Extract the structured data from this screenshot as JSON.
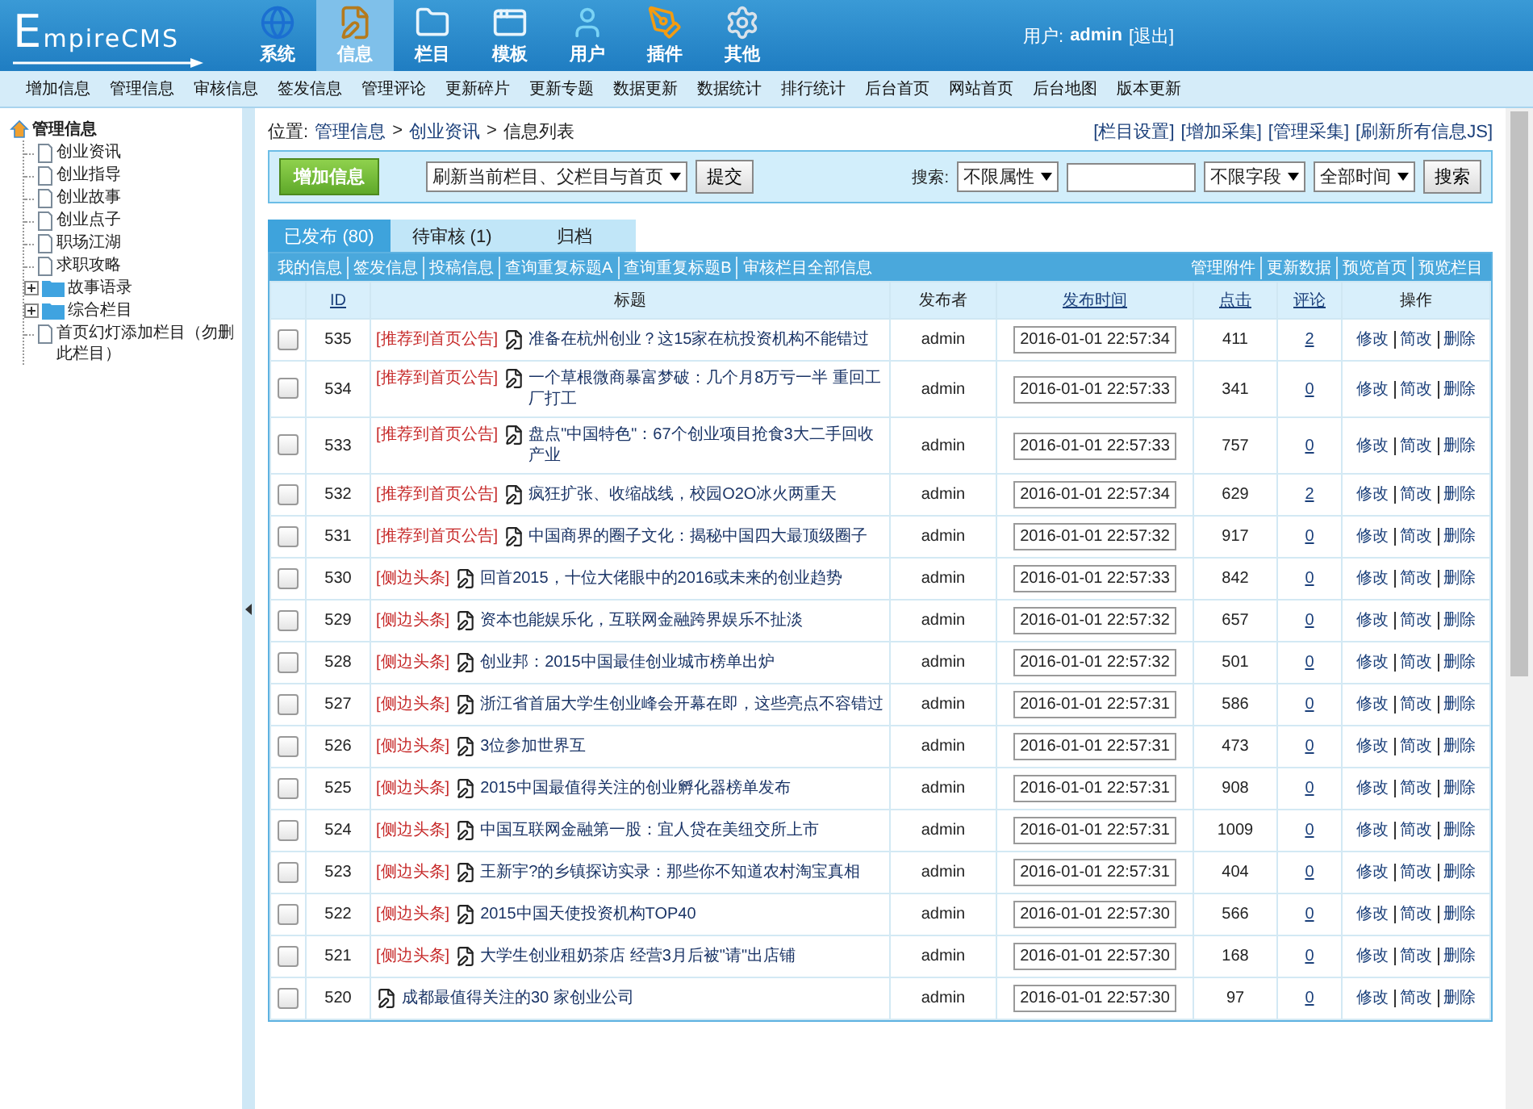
{
  "header": {
    "logo": "EmpireCMS",
    "nav": [
      {
        "label": "系统",
        "selected": false
      },
      {
        "label": "信息",
        "selected": true
      },
      {
        "label": "栏目",
        "selected": false
      },
      {
        "label": "模板",
        "selected": false
      },
      {
        "label": "用户",
        "selected": false
      },
      {
        "label": "插件",
        "selected": false
      },
      {
        "label": "其他",
        "selected": false
      }
    ],
    "user_label": "用户:",
    "user_name": "admin",
    "logout": "[退出]"
  },
  "submenu": [
    "增加信息",
    "管理信息",
    "审核信息",
    "签发信息",
    "管理评论",
    "更新碎片",
    "更新专题",
    "数据更新",
    "数据统计",
    "排行统计",
    "后台首页",
    "网站首页",
    "后台地图",
    "版本更新"
  ],
  "sidebar": {
    "root": "管理信息",
    "items": [
      {
        "kind": "page",
        "label": "创业资讯"
      },
      {
        "kind": "page",
        "label": "创业指导"
      },
      {
        "kind": "page",
        "label": "创业故事"
      },
      {
        "kind": "page",
        "label": "创业点子"
      },
      {
        "kind": "page",
        "label": "职场江湖"
      },
      {
        "kind": "page",
        "label": "求职攻略"
      },
      {
        "kind": "folder",
        "label": "故事语录",
        "expanded": false
      },
      {
        "kind": "folder",
        "label": "综合栏目",
        "expanded": false
      },
      {
        "kind": "page",
        "label": "首页幻灯添加栏目（勿删此栏目）"
      }
    ]
  },
  "breadcrumb": {
    "label": "位置:",
    "separator": ">",
    "items": [
      "管理信息",
      "创业资讯",
      "信息列表"
    ]
  },
  "top_links": [
    "[栏目设置]",
    "[增加采集]",
    "[管理采集]",
    "[刷新所有信息JS]"
  ],
  "toolbar": {
    "add_button": "增加信息",
    "refresh_select": "刷新当前栏目、父栏目与首页",
    "submit_button": "提交",
    "search_label": "搜索:",
    "attribute_select": "不限属性",
    "field_select": "不限字段",
    "time_select": "全部时间",
    "search_button": "搜索"
  },
  "tabs": [
    {
      "label": "已发布 (80)",
      "selected": true
    },
    {
      "label": "待审核 (1)",
      "selected": false
    },
    {
      "label": "归档",
      "selected": false
    }
  ],
  "action_links_left": [
    "我的信息",
    "签发信息",
    "投稿信息",
    "查询重复标题A",
    "查询重复标题B",
    "审核栏目全部信息"
  ],
  "action_links_right": [
    "管理附件",
    "更新数据",
    "预览首页",
    "预览栏目"
  ],
  "table": {
    "columns": [
      {
        "label": "ID",
        "link": true
      },
      {
        "label": "标题",
        "link": false
      },
      {
        "label": "发布者",
        "link": false
      },
      {
        "label": "发布时间",
        "link": true
      },
      {
        "label": "点击",
        "link": true
      },
      {
        "label": "评论",
        "link": true
      },
      {
        "label": "操作",
        "link": false
      }
    ],
    "rows": [
      {
        "checked": false,
        "id": "535",
        "tag": "[推荐到首页公告]",
        "title": "准备在杭州创业？这15家在杭投资机构不能错过",
        "author": "admin",
        "time": "2016-01-01 22:57:34",
        "clicks": "411",
        "comments": "2",
        "actions": [
          "修改",
          "简改",
          "删除"
        ]
      },
      {
        "checked": false,
        "id": "534",
        "tag": "[推荐到首页公告]",
        "title": "一个草根微商暴富梦破：几个月8万亏一半 重回工厂打工",
        "author": "admin",
        "time": "2016-01-01 22:57:33",
        "clicks": "341",
        "comments": "0",
        "actions": [
          "修改",
          "简改",
          "删除"
        ]
      },
      {
        "checked": false,
        "id": "533",
        "tag": "[推荐到首页公告]",
        "title": "盘点\"中国特色\"：67个创业项目抢食3大二手回收产业",
        "author": "admin",
        "time": "2016-01-01 22:57:33",
        "clicks": "757",
        "comments": "0",
        "actions": [
          "修改",
          "简改",
          "删除"
        ]
      },
      {
        "checked": false,
        "id": "532",
        "tag": "[推荐到首页公告]",
        "title": "疯狂扩张、收缩战线，校园O2O冰火两重天",
        "author": "admin",
        "time": "2016-01-01 22:57:34",
        "clicks": "629",
        "comments": "2",
        "actions": [
          "修改",
          "简改",
          "删除"
        ]
      },
      {
        "checked": false,
        "id": "531",
        "tag": "[推荐到首页公告]",
        "title": "中国商界的圈子文化：揭秘中国四大最顶级圈子",
        "author": "admin",
        "time": "2016-01-01 22:57:32",
        "clicks": "917",
        "comments": "0",
        "actions": [
          "修改",
          "简改",
          "删除"
        ]
      },
      {
        "checked": false,
        "id": "530",
        "tag": "[侧边头条]",
        "title": "回首2015，十位大佬眼中的2016或未来的创业趋势",
        "author": "admin",
        "time": "2016-01-01 22:57:33",
        "clicks": "842",
        "comments": "0",
        "actions": [
          "修改",
          "简改",
          "删除"
        ]
      },
      {
        "checked": false,
        "id": "529",
        "tag": "[侧边头条]",
        "title": "资本也能娱乐化，互联网金融跨界娱乐不扯淡",
        "author": "admin",
        "time": "2016-01-01 22:57:32",
        "clicks": "657",
        "comments": "0",
        "actions": [
          "修改",
          "简改",
          "删除"
        ]
      },
      {
        "checked": false,
        "id": "528",
        "tag": "[侧边头条]",
        "title": "创业邦：2015中国最佳创业城市榜单出炉",
        "author": "admin",
        "time": "2016-01-01 22:57:32",
        "clicks": "501",
        "comments": "0",
        "actions": [
          "修改",
          "简改",
          "删除"
        ]
      },
      {
        "checked": false,
        "id": "527",
        "tag": "[侧边头条]",
        "title": "浙江省首届大学生创业峰会开幕在即，这些亮点不容错过",
        "author": "admin",
        "time": "2016-01-01 22:57:31",
        "clicks": "586",
        "comments": "0",
        "actions": [
          "修改",
          "简改",
          "删除"
        ]
      },
      {
        "checked": false,
        "id": "526",
        "tag": "[侧边头条]",
        "title": "3位参加世界互",
        "author": "admin",
        "time": "2016-01-01 22:57:31",
        "clicks": "473",
        "comments": "0",
        "actions": [
          "修改",
          "简改",
          "删除"
        ]
      },
      {
        "checked": false,
        "id": "525",
        "tag": "[侧边头条]",
        "title": "2015中国最值得关注的创业孵化器榜单发布",
        "author": "admin",
        "time": "2016-01-01 22:57:31",
        "clicks": "908",
        "comments": "0",
        "actions": [
          "修改",
          "简改",
          "删除"
        ]
      },
      {
        "checked": false,
        "id": "524",
        "tag": "[侧边头条]",
        "title": "中国互联网金融第一股：宜人贷在美纽交所上市",
        "author": "admin",
        "time": "2016-01-01 22:57:31",
        "clicks": "1009",
        "comments": "0",
        "actions": [
          "修改",
          "简改",
          "删除"
        ]
      },
      {
        "checked": false,
        "id": "523",
        "tag": "[侧边头条]",
        "title": "王新宇?的乡镇探访实录：那些你不知道农村淘宝真相",
        "author": "admin",
        "time": "2016-01-01 22:57:31",
        "clicks": "404",
        "comments": "0",
        "actions": [
          "修改",
          "简改",
          "删除"
        ]
      },
      {
        "checked": false,
        "id": "522",
        "tag": "[侧边头条]",
        "title": "2015中国天使投资机构TOP40",
        "author": "admin",
        "time": "2016-01-01 22:57:30",
        "clicks": "566",
        "comments": "0",
        "actions": [
          "修改",
          "简改",
          "删除"
        ]
      },
      {
        "checked": false,
        "id": "521",
        "tag": "[侧边头条]",
        "title": "大学生创业租奶茶店 经营3月后被\"请\"出店铺",
        "author": "admin",
        "time": "2016-01-01 22:57:30",
        "clicks": "168",
        "comments": "0",
        "actions": [
          "修改",
          "简改",
          "删除"
        ]
      },
      {
        "checked": false,
        "id": "520",
        "title": "成都最值得关注的30 家创业公司",
        "author": "admin",
        "time": "2016-01-01 22:57:30",
        "clicks": "97",
        "comments": "0",
        "actions": [
          "修改",
          "简改",
          "删除"
        ]
      }
    ]
  }
}
